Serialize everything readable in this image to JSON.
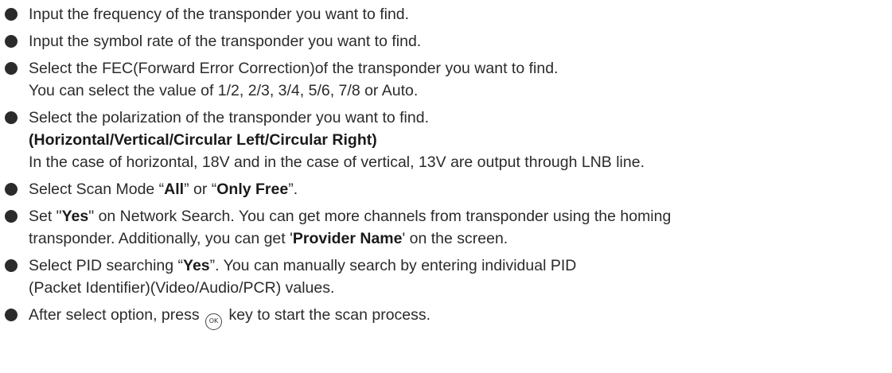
{
  "items": [
    {
      "text": "Input the frequency of the transponder you want to find."
    },
    {
      "text": "Input the symbol rate of the transponder you want to find."
    },
    {
      "line1": "Select the FEC(Forward Error Correction)of the transponder you want to find.",
      "line2": "You can select the value of 1/2, 2/3, 3/4, 5/6, 7/8 or Auto."
    },
    {
      "line1": "Select the polarization of the transponder you want to find.",
      "line2_bold": "(Horizontal/Vertical/Circular Left/Circular Right)",
      "line3": "In the case of horizontal, 18V and in the case of vertical, 13V are output through LNB line."
    },
    {
      "pre": "Select Scan Mode “",
      "bold1": "All",
      "mid": "” or “",
      "bold2": "Only Free",
      "post": "”."
    },
    {
      "pre": "Set \"",
      "bold1": "Yes",
      "mid": "\" on Network Search. You can get more channels from transponder using the homing",
      "line2_pre": "transponder. Additionally, you can get '",
      "bold2": "Provider Name",
      "line2_post": "' on the screen."
    },
    {
      "pre": "Select PID searching “",
      "bold1": "Yes",
      "mid": "”. You can manually search by entering individual PID",
      "line2": "(Packet Identifier)(Video/Audio/PCR) values."
    },
    {
      "pre": "After select option, press",
      "icon_label": "OK",
      "post": "key to start the scan process."
    }
  ],
  "icons": {
    "bullet": "bullet-dot-icon",
    "ok_key": "ok-button-icon"
  }
}
